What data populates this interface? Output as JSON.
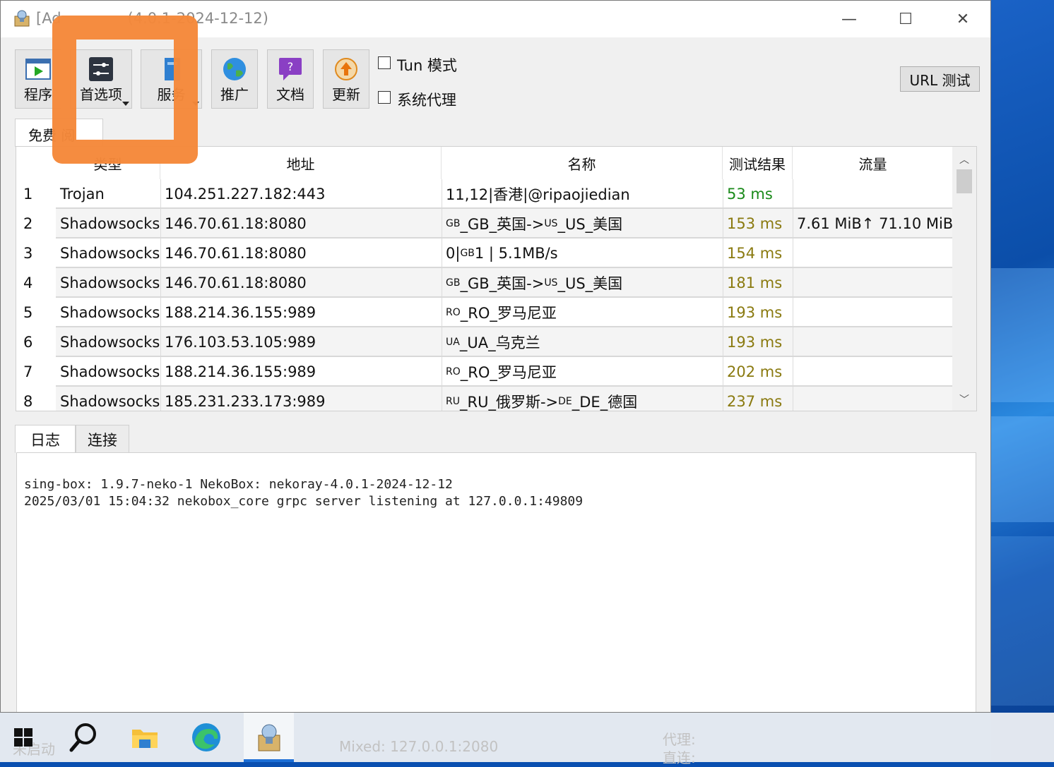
{
  "window": {
    "title": "[Ad",
    "title_suffix": "(4.0.1-2024-12-12)",
    "controls": [
      "—",
      "☐",
      "✕"
    ]
  },
  "toolbar": {
    "buttons": [
      {
        "label": "程序",
        "icon": "play-window-icon"
      },
      {
        "label": "首选项",
        "icon": "settings-sliders-icon",
        "has_dropdown": true
      },
      {
        "label": "服务",
        "icon": "server-icon",
        "has_dropdown": true
      },
      {
        "label": "推广",
        "icon": "globe-icon"
      },
      {
        "label": "文档",
        "icon": "help-chat-icon"
      },
      {
        "label": "更新",
        "icon": "update-arrow-icon"
      }
    ],
    "tun_mode_label": "Tun 模式",
    "system_proxy_label": "系统代理",
    "url_test_label": "URL 测试"
  },
  "group_tab": "免费 阅",
  "table": {
    "headers": [
      "类型",
      "地址",
      "名称",
      "测试结果",
      "流量"
    ],
    "rows": [
      {
        "index": "1",
        "type": "Trojan",
        "address": "104.251.227.182:443",
        "name_prefix": "",
        "name": "11,12|香港|@ripaojiedian",
        "latency": "53 ms",
        "latency_color": "#1a8a1a",
        "traffic": ""
      },
      {
        "index": "2",
        "type": "Shadowsocks",
        "address": "146.70.61.18:8080",
        "name_prefix": "GB",
        "name": "_GB_英国->",
        "name_mid": "US",
        "name_tail": "_US_美国",
        "latency": "153 ms",
        "latency_color": "#8a7a10",
        "traffic": "7.61 MiB↑ 71.10 MiB↓"
      },
      {
        "index": "3",
        "type": "Shadowsocks",
        "address": "146.70.61.18:8080",
        "name_prefix": "",
        "name": "0|",
        "name_mid": "GB",
        "name_tail": "1 |  5.1MB/s",
        "latency": "154 ms",
        "latency_color": "#8a7a10",
        "traffic": ""
      },
      {
        "index": "4",
        "type": "Shadowsocks",
        "address": "146.70.61.18:8080",
        "name_prefix": "GB",
        "name": "_GB_英国->",
        "name_mid": "US",
        "name_tail": "_US_美国",
        "latency": "181 ms",
        "latency_color": "#8a7a10",
        "traffic": ""
      },
      {
        "index": "5",
        "type": "Shadowsocks",
        "address": "188.214.36.155:989",
        "name_prefix": "RO",
        "name": "_RO_罗马尼亚",
        "name_mid": "",
        "name_tail": "",
        "latency": "193 ms",
        "latency_color": "#8a7a10",
        "traffic": ""
      },
      {
        "index": "6",
        "type": "Shadowsocks",
        "address": "176.103.53.105:989",
        "name_prefix": "UA",
        "name": "_UA_乌克兰",
        "name_mid": "",
        "name_tail": "",
        "latency": "193 ms",
        "latency_color": "#8a7a10",
        "traffic": ""
      },
      {
        "index": "7",
        "type": "Shadowsocks",
        "address": "188.214.36.155:989",
        "name_prefix": "RO",
        "name": "_RO_罗马尼亚",
        "name_mid": "",
        "name_tail": "",
        "latency": "202 ms",
        "latency_color": "#8a7a10",
        "traffic": ""
      },
      {
        "index": "8",
        "type": "Shadowsocks",
        "address": "185.231.233.173:989",
        "name_prefix": "RU",
        "name": "_RU_俄罗斯->",
        "name_mid": "DE",
        "name_tail": "_DE_德国",
        "latency": "237 ms",
        "latency_color": "#8a7a10",
        "traffic": ""
      }
    ]
  },
  "bottom_tabs": [
    "日志",
    "连接"
  ],
  "log": {
    "lines": [
      "sing-box: 1.9.7-neko-1 NekoBox: nekoray-4.0.1-2024-12-12",
      "2025/03/01 15:04:32 nekobox_core grpc server listening at 127.0.0.1:49809"
    ]
  },
  "status": {
    "left": "未启动",
    "mixed": "Mixed: 127.0.0.1:2080",
    "proxy": "代理:",
    "direct": "直连:"
  },
  "taskbar": {
    "items": [
      "windows-start-icon",
      "search-icon",
      "file-explorer-icon",
      "edge-browser-icon",
      "nekobox-app-icon"
    ]
  },
  "colors": {
    "highlight": "#f5883a",
    "latency_good": "#1a8a1a",
    "latency_mid": "#8a7a10",
    "taskbar_accent": "#1d6fd6"
  }
}
